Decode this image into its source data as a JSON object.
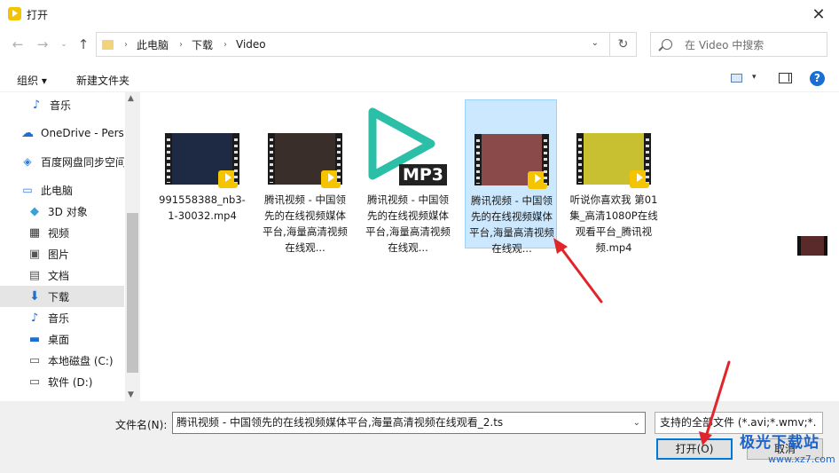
{
  "window": {
    "title": "打开",
    "close_glyph": "✕"
  },
  "nav": {
    "back_glyph": "←",
    "forward_glyph": "→",
    "recent_glyph": "⌄",
    "up_glyph": "↑",
    "breadcrumbs": [
      "此电脑",
      "下载",
      "Video"
    ],
    "crumb_sep": "›",
    "dropdown_glyph": "⌄",
    "refresh_glyph": "↻",
    "search_placeholder": "在 Video 中搜索"
  },
  "toolbar": {
    "organize": "组织 ▾",
    "new_folder": "新建文件夹",
    "view_drop_glyph": "▾",
    "help": "?"
  },
  "sidebar": {
    "items": [
      {
        "label": "音乐",
        "icon": "music-note-icon"
      },
      {
        "label": "OneDrive - Personal",
        "icon": "cloud-icon"
      },
      {
        "label": "百度网盘同步空间",
        "icon": "baidu-netdisk-icon"
      },
      {
        "label": "此电脑",
        "icon": "computer-icon"
      },
      {
        "label": "3D 对象",
        "icon": "3d-objects-icon"
      },
      {
        "label": "视频",
        "icon": "video-folder-icon"
      },
      {
        "label": "图片",
        "icon": "pictures-icon"
      },
      {
        "label": "文档",
        "icon": "documents-icon"
      },
      {
        "label": "下载",
        "icon": "download-icon",
        "selected": true
      },
      {
        "label": "音乐",
        "icon": "music-note-icon"
      },
      {
        "label": "桌面",
        "icon": "desktop-icon"
      },
      {
        "label": "本地磁盘 (C:)",
        "icon": "drive-c-icon"
      },
      {
        "label": "软件 (D:)",
        "icon": "drive-d-icon"
      }
    ],
    "scroll_up": "▲",
    "scroll_down": "▼"
  },
  "files": [
    {
      "name": "991558388_nb3-1-30032.mp4",
      "type": "video",
      "badge": "Player",
      "thumb_color": "#1e2a44"
    },
    {
      "name": "腾讯视频 - 中国领先的在线视频媒体平台,海量高清视频在线观...",
      "type": "video",
      "badge": "Player",
      "thumb_color": "#3a2e2a"
    },
    {
      "name": "腾讯视频 - 中国领先的在线视频媒体平台,海量高清视频在线观...",
      "type": "mp3",
      "mp3_label": "MP3"
    },
    {
      "name": "腾讯视频 - 中国领先的在线视频媒体平台,海量高清视频在线观...",
      "type": "video",
      "badge": "Player",
      "thumb_color": "#8a4a4a",
      "selected": true
    },
    {
      "name": "听说你喜欢我 第01集_高清1080P在线观看平台_腾讯视频.mp4",
      "type": "video",
      "badge": "Player",
      "thumb_color": "#c8c030"
    }
  ],
  "bottom": {
    "filename_label": "文件名(N):",
    "filename_value": "腾讯视频 - 中国领先的在线视频媒体平台,海量高清视频在线观看_2.ts",
    "filter_value": "支持的全部文件 (*.avi;*.wmv;*.",
    "open_button": "打开(O)",
    "cancel_button": "取消",
    "dropdown_glyph": "⌄"
  },
  "watermark": {
    "brand": "极光下载站",
    "url": "www.xz7.com"
  },
  "colors": {
    "accent": "#0078d7",
    "selection": "#cce8ff",
    "annotation_arrow": "#e0262b",
    "teal_play": "#2bbfa8"
  }
}
